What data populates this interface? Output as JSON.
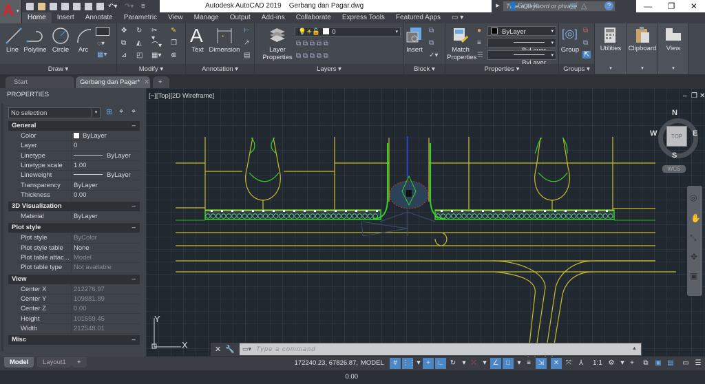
{
  "app": {
    "title": "Autodesk AutoCAD 2019    Gerbang dan Pagar.dwg",
    "search_placeholder": "Type a keyword or phrase",
    "sign_in": "Sign In",
    "window_controls": {
      "minimize": "—",
      "restore": "❐",
      "close": "✕"
    }
  },
  "ribbon_tabs": [
    "Home",
    "Insert",
    "Annotate",
    "Parametric",
    "View",
    "Manage",
    "Output",
    "Add-ins",
    "Collaborate",
    "Express Tools",
    "Featured Apps"
  ],
  "active_ribbon_tab": "Home",
  "ribbon": {
    "draw": {
      "label": "Draw ▾",
      "tools": [
        "Line",
        "Polyline",
        "Circle",
        "Arc"
      ]
    },
    "modify": {
      "label": "Modify ▾"
    },
    "annotation": {
      "label": "Annotation ▾",
      "tools": [
        "Text",
        "Dimension"
      ]
    },
    "layers": {
      "label": "Layers ▾",
      "layer_properties": "Layer Properties",
      "current_layer": "0"
    },
    "block": {
      "label": "Block ▾",
      "insert": "Insert"
    },
    "properties": {
      "label": "Properties ▾",
      "match": "Match Properties",
      "color": "ByLayer",
      "linetype": "ByLayer",
      "lineweight": "ByLayer"
    },
    "groups": {
      "label": "Groups ▾",
      "group": "Group"
    },
    "utilities": "Utilities",
    "clipboard": "Clipboard",
    "view": "View"
  },
  "doc_tabs": [
    {
      "label": "Start",
      "active": false
    },
    {
      "label": "Gerbang dan Pagar*",
      "active": true
    }
  ],
  "palette": {
    "title": "PROPERTIES",
    "selection": "No selection",
    "sections": [
      {
        "name": "General",
        "rows": [
          {
            "k": "Color",
            "v": "ByLayer"
          },
          {
            "k": "Layer",
            "v": "0"
          },
          {
            "k": "Linetype",
            "v": "ByLayer"
          },
          {
            "k": "Linetype scale",
            "v": "1.00"
          },
          {
            "k": "Lineweight",
            "v": "ByLayer"
          },
          {
            "k": "Transparency",
            "v": "ByLayer"
          },
          {
            "k": "Thickness",
            "v": "0.00"
          }
        ]
      },
      {
        "name": "3D Visualization",
        "rows": [
          {
            "k": "Material",
            "v": "ByLayer"
          }
        ]
      },
      {
        "name": "Plot style",
        "rows": [
          {
            "k": "Plot style",
            "v": "ByColor"
          },
          {
            "k": "Plot style table",
            "v": "None"
          },
          {
            "k": "Plot table attac...",
            "v": "Model"
          },
          {
            "k": "Plot table type",
            "v": "Not available"
          }
        ]
      },
      {
        "name": "View",
        "rows": [
          {
            "k": "Center X",
            "v": "212276.97"
          },
          {
            "k": "Center Y",
            "v": "109881.89"
          },
          {
            "k": "Center Z",
            "v": "0.00"
          },
          {
            "k": "Height",
            "v": "101559.45"
          },
          {
            "k": "Width",
            "v": "212548.01"
          }
        ]
      },
      {
        "name": "Misc",
        "rows": []
      }
    ]
  },
  "viewport": {
    "label": "[−][Top][2D Wireframe]",
    "viewcube": {
      "face": "TOP",
      "n": "N",
      "s": "S",
      "e": "E",
      "w": "W",
      "ucs": "WCS"
    },
    "ucs_x": "X",
    "ucs_y": "Y"
  },
  "command": {
    "placeholder": "Type a command"
  },
  "layout_tabs": [
    "Model",
    "Layout1"
  ],
  "status": {
    "coords": "172240.23, 67826.87, 0.00",
    "space": "MODEL",
    "scale": "1:1"
  },
  "colors": {
    "accent": "#4d86c4",
    "drawing_yellow": "#c8c02a",
    "drawing_green": "#34d12a",
    "background": "#212830"
  }
}
